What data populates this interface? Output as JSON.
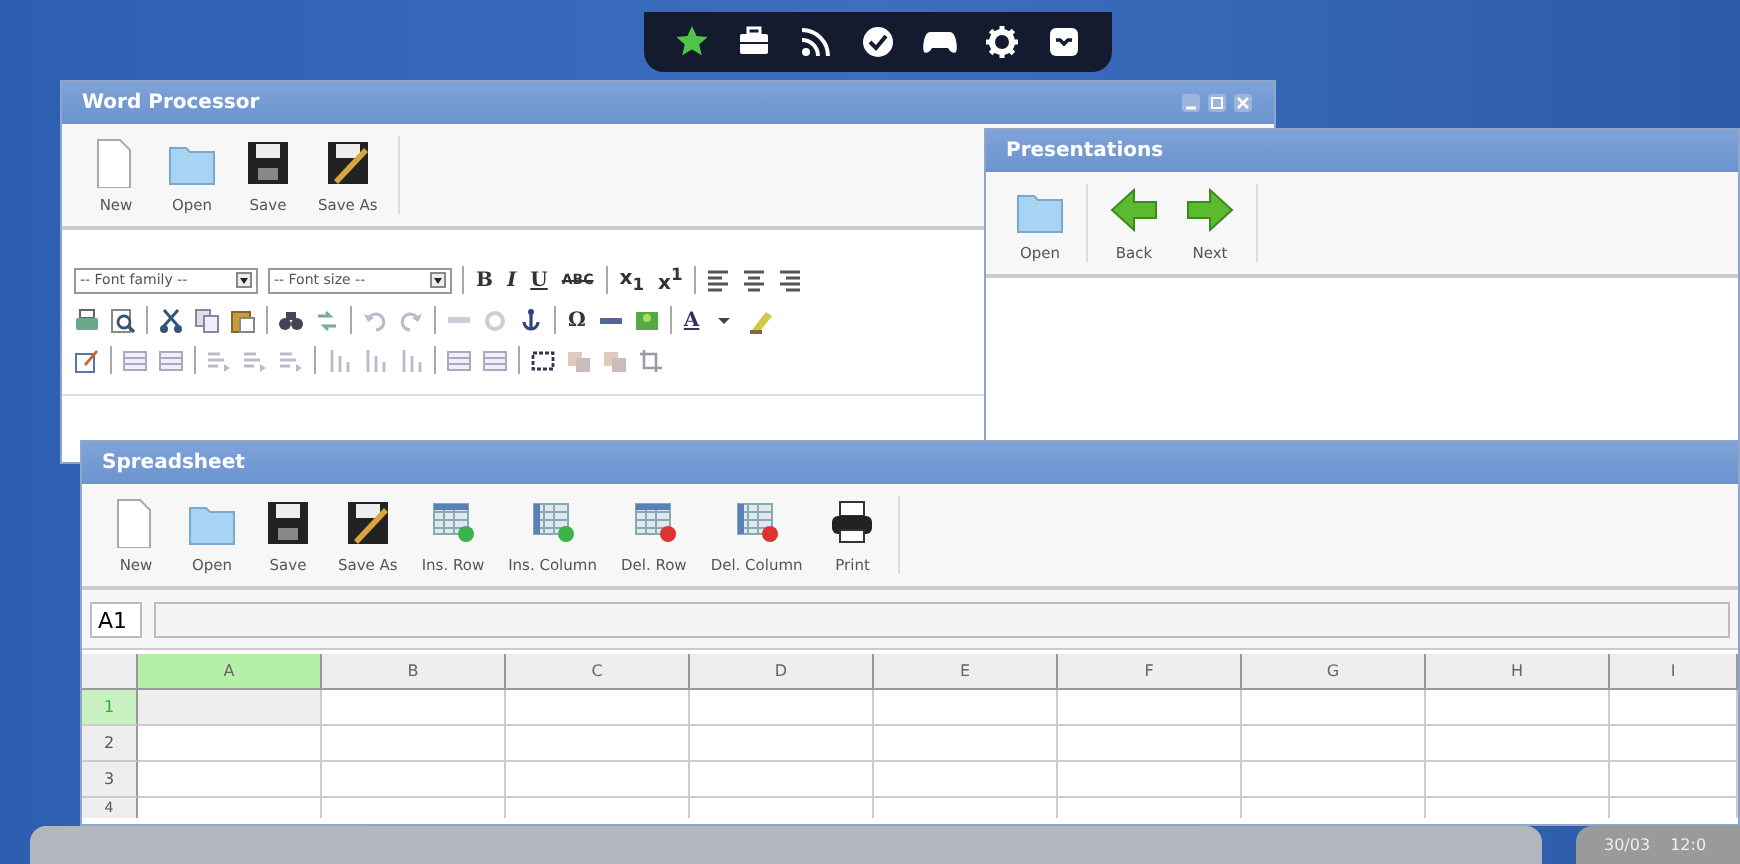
{
  "word_processor": {
    "title": "Word Processor",
    "toolbar": [
      {
        "label": "New"
      },
      {
        "label": "Open"
      },
      {
        "label": "Save"
      },
      {
        "label": "Save As"
      }
    ],
    "editor_toolbar": [
      [
        {
          "kind": "select",
          "text": "-- Font family --"
        },
        {
          "kind": "select",
          "text": "-- Font size --"
        },
        {
          "kind": "bold",
          "text": "B"
        },
        {
          "kind": "italic",
          "text": "I"
        },
        {
          "kind": "underline",
          "text": "U"
        },
        {
          "kind": "strike",
          "text": "ABC"
        },
        {
          "kind": "script",
          "text": "x$_{1}$"
        },
        {
          "kind": "script",
          "text": "x$^{1}$"
        }
      ],
      [
        {
          "kind": "symbol",
          "text": "Ω"
        },
        {
          "kind": "color",
          "text": "A"
        }
      ]
    ]
  },
  "presentations": {
    "title": "Presentations",
    "toolbar": [
      {
        "label": "Open"
      },
      {
        "label": "Back"
      },
      {
        "label": "Next"
      }
    ]
  },
  "spreadsheet": {
    "title": "Spreadsheet",
    "toolbar": [
      {
        "label": "New"
      },
      {
        "label": "Open"
      },
      {
        "label": "Save"
      },
      {
        "label": "Save As"
      },
      {
        "label": "Ins. Row"
      },
      {
        "label": "Ins. Column"
      },
      {
        "label": "Del. Row"
      },
      {
        "label": "Del. Column"
      },
      {
        "label": "Print"
      }
    ],
    "cell_ref": "A1",
    "columns": [
      {
        "label": "A",
        "selected": true
      },
      {
        "label": "B",
        "selected": false
      },
      {
        "label": "C",
        "selected": false
      },
      {
        "label": "D",
        "selected": false
      },
      {
        "label": "E",
        "selected": false
      },
      {
        "label": "F",
        "selected": false
      },
      {
        "label": "G",
        "selected": false
      },
      {
        "label": "H",
        "selected": false
      },
      {
        "label": "I",
        "selected": false
      }
    ],
    "rows": [
      {
        "label": "1",
        "selected": true
      },
      {
        "label": "2",
        "selected": false
      },
      {
        "label": "3",
        "selected": false
      },
      {
        "label": "4",
        "selected": false
      }
    ]
  },
  "taskbar": {
    "date": "30/03",
    "time": "12:0"
  }
}
